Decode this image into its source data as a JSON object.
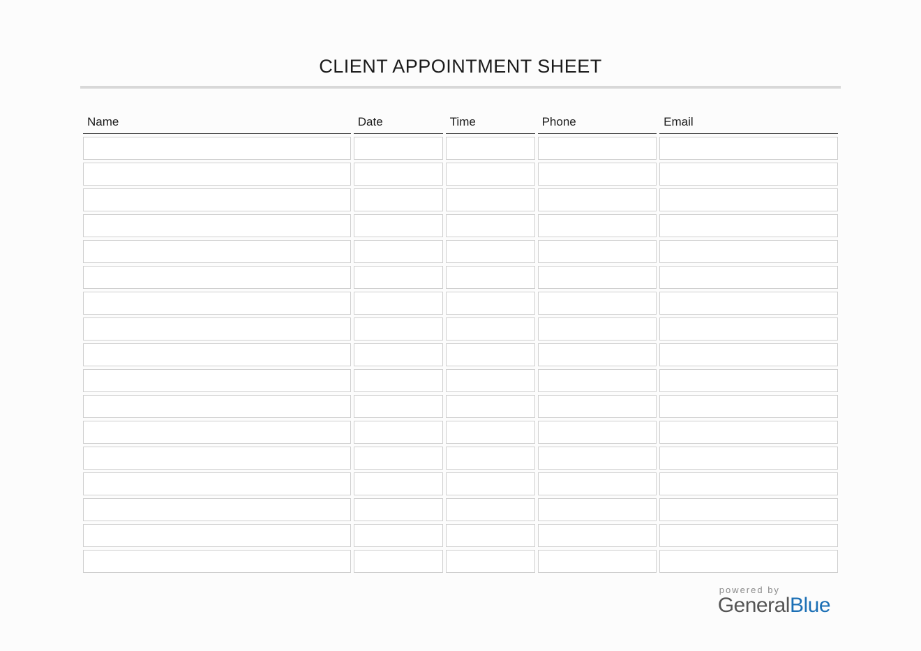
{
  "title": "CLIENT APPOINTMENT SHEET",
  "columns": {
    "name": "Name",
    "date": "Date",
    "time": "Time",
    "phone": "Phone",
    "email": "Email"
  },
  "rowCount": 17,
  "footer": {
    "poweredBy": "powered by",
    "brandPart1": "General",
    "brandPart2": "Blue"
  }
}
